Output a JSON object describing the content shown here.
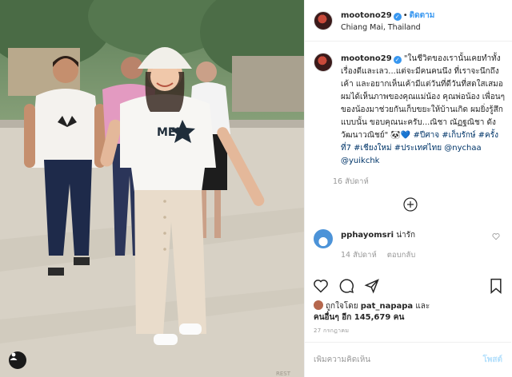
{
  "photo": {
    "alt_overlay_text": "MEN",
    "shirt_text": "MEN",
    "corner_text": "REST"
  },
  "header": {
    "username": "mootono29",
    "verified_icon": "verified-badge-icon",
    "separator": "•",
    "follow_label": "ติดตาม",
    "location": "Chiang Mai, Thailand"
  },
  "caption": {
    "username": "mootono29",
    "text_part1": "\"ในชีวิตของเรานั้นเคยทำทั้งเรื่องดีและเลว...แต่จะมีคนคนนึง ที่เราจะนึกถึงเค้า และอยากเห็นเค้ามีแต่วันที่ดีวันที่สดใสเสมอ ผมได้เห็นภาพของคุณแม่น้อง คุณพ่อน้อง เพื่อนๆของน้องมาช่วยกันเก็บขยะให้บ้านเกิด ผมยิ่งรู้สึกแบบนั้น ขอบคุณนะครับ...ณิชา ณัฏฐณิชา ดังวัฒนาวณิชย์\" 🐼💙",
    "hashtags": [
      "#ปีศาจ",
      "#เก็บรักษ์",
      "#ครั้งที่7",
      "#เชียงใหม่",
      "#ประเทศไทย"
    ],
    "mentions": [
      "@nychaa",
      "@yuikchk"
    ],
    "time": "16 สัปดาห์"
  },
  "comment": {
    "username": "pphayomsri",
    "text": "น่ารัก",
    "time": "14 สัปดาห์",
    "reply_label": "ตอบกลับ"
  },
  "actions": {
    "like_icon": "heart-icon",
    "comment_icon": "comment-icon",
    "share_icon": "share-icon",
    "save_icon": "bookmark-icon"
  },
  "likes": {
    "prefix": "ถูกใจโดย",
    "user": "pat_napapa",
    "middle": "และ",
    "others_label": "คนอื่นๆ อีก 145,679 คน"
  },
  "date": "27 กรกฎาคม",
  "add_comment": {
    "placeholder": "เพิ่มความคิดเห็น",
    "post_label": "โพสต์"
  },
  "colors": {
    "link": "#003569",
    "follow": "#3897f0",
    "muted": "#999999",
    "post_disabled": "#b2dffc"
  }
}
